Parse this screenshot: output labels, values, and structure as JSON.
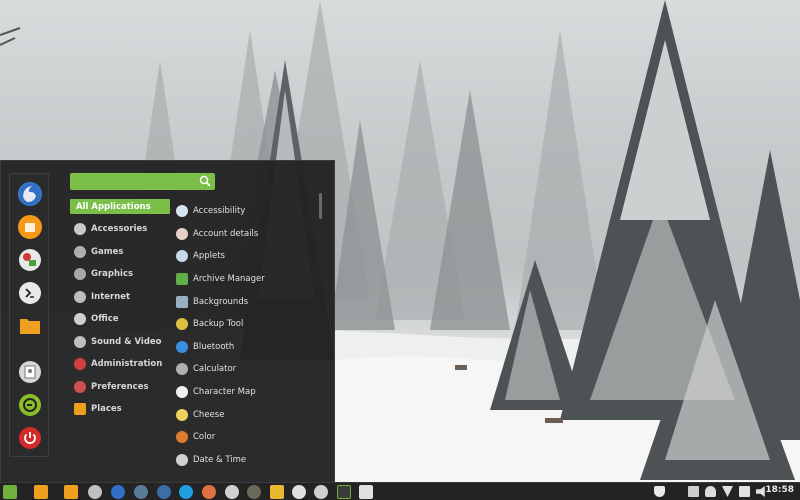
{
  "colors": {
    "accent": "#7bbf48",
    "menu_bg": "#222222",
    "taskbar_bg": "#232323"
  },
  "favorites": [
    {
      "name": "firefox-icon"
    },
    {
      "name": "software-manager-icon"
    },
    {
      "name": "settings-icon"
    },
    {
      "name": "terminal-icon"
    },
    {
      "name": "files-icon"
    },
    {
      "name": "lock-screen-icon"
    },
    {
      "name": "logout-icon"
    },
    {
      "name": "shutdown-icon"
    }
  ],
  "search": {
    "placeholder": "",
    "value": ""
  },
  "categories": [
    {
      "label": "All Applications",
      "icon": "",
      "active": true
    },
    {
      "label": "Accessories",
      "icon": "accessories-icon"
    },
    {
      "label": "Games",
      "icon": "games-icon"
    },
    {
      "label": "Graphics",
      "icon": "graphics-icon"
    },
    {
      "label": "Internet",
      "icon": "internet-icon"
    },
    {
      "label": "Office",
      "icon": "office-icon"
    },
    {
      "label": "Sound & Video",
      "icon": "sound-video-icon"
    },
    {
      "label": "Administration",
      "icon": "administration-icon"
    },
    {
      "label": "Preferences",
      "icon": "preferences-icon"
    },
    {
      "label": "Places",
      "icon": "places-folder-icon"
    }
  ],
  "apps": [
    {
      "label": "Accessibility",
      "icon": "accessibility-icon",
      "color": "#d8e4f0"
    },
    {
      "label": "Account details",
      "icon": "account-icon",
      "color": "#e8d0c8"
    },
    {
      "label": "Applets",
      "icon": "applets-icon",
      "color": "#c8d8e8"
    },
    {
      "label": "Archive Manager",
      "icon": "archive-icon",
      "color": "#5fb04a"
    },
    {
      "label": "Backgrounds",
      "icon": "backgrounds-icon",
      "color": "#9ab0c0"
    },
    {
      "label": "Backup Tool",
      "icon": "backup-icon",
      "color": "#e0c040"
    },
    {
      "label": "Bluetooth",
      "icon": "bluetooth-icon",
      "color": "#3a8ee0"
    },
    {
      "label": "Calculator",
      "icon": "calculator-icon",
      "color": "#b0b0b0"
    },
    {
      "label": "Character Map",
      "icon": "character-map-icon",
      "color": "#f0f0f0"
    },
    {
      "label": "Cheese",
      "icon": "cheese-icon",
      "color": "#f0d060"
    },
    {
      "label": "Color",
      "icon": "color-icon",
      "color": "#e07a30"
    },
    {
      "label": "Date & Time",
      "icon": "date-time-icon",
      "color": "#d0d0d0"
    }
  ],
  "taskbar": {
    "clock": "18:58"
  }
}
